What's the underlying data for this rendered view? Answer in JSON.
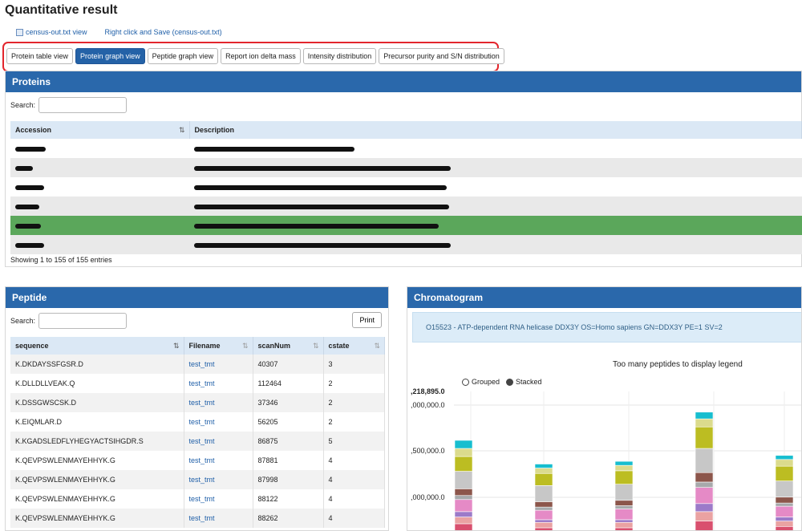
{
  "page": {
    "title": "Quantitative result"
  },
  "links": {
    "view": "census-out.txt view",
    "save": "Right click and Save (census-out.txt)"
  },
  "tabs": [
    {
      "label": "Protein table view",
      "active": false
    },
    {
      "label": "Protein graph view",
      "active": true
    },
    {
      "label": "Peptide graph view",
      "active": false
    },
    {
      "label": "Report ion delta mass",
      "active": false
    },
    {
      "label": "Intensity distribution",
      "active": false
    },
    {
      "label": "Precursor purity and S/N distribution",
      "active": false
    }
  ],
  "proteins": {
    "title": "Proteins",
    "search_label": "Search:",
    "search_value": "",
    "columns": {
      "accession": "Accession",
      "description": "Description"
    },
    "rows": [
      {
        "highlighted": false
      },
      {
        "highlighted": false
      },
      {
        "highlighted": false
      },
      {
        "highlighted": false
      },
      {
        "highlighted": true
      },
      {
        "highlighted": false
      }
    ],
    "footer": "Showing 1 to 155 of 155 entries"
  },
  "peptide": {
    "title": "Peptide",
    "search_label": "Search:",
    "search_value": "",
    "print_label": "Print",
    "columns": {
      "sequence": "sequence",
      "filename": "Filename",
      "scan": "scanNum",
      "cstate": "cstate"
    },
    "rows": [
      {
        "sequence": "K.DKDAYSSFGSR.D",
        "filename": "test_tmt",
        "scan": "40307",
        "cstate": "3"
      },
      {
        "sequence": "K.DLLDLLVEAK.Q",
        "filename": "test_tmt",
        "scan": "112464",
        "cstate": "2"
      },
      {
        "sequence": "K.DSSGWSCSK.D",
        "filename": "test_tmt",
        "scan": "37346",
        "cstate": "2"
      },
      {
        "sequence": "K.EIQMLAR.D",
        "filename": "test_tmt",
        "scan": "56205",
        "cstate": "2"
      },
      {
        "sequence": "K.KGADSLEDFLYHEGYACTSIHGDR.S",
        "filename": "test_tmt",
        "scan": "86875",
        "cstate": "5"
      },
      {
        "sequence": "K.QEVPSWLENMAYEHHYK.G",
        "filename": "test_tmt",
        "scan": "87881",
        "cstate": "4"
      },
      {
        "sequence": "K.QEVPSWLENMAYEHHYK.G",
        "filename": "test_tmt",
        "scan": "87998",
        "cstate": "4"
      },
      {
        "sequence": "K.QEVPSWLENMAYEHHYK.G",
        "filename": "test_tmt",
        "scan": "88122",
        "cstate": "4"
      },
      {
        "sequence": "K.QEVPSWLENMAYEHHYK.G",
        "filename": "test_tmt",
        "scan": "88262",
        "cstate": "4"
      }
    ]
  },
  "chromatogram": {
    "title": "Chromatogram",
    "info": "O15523 - ATP-dependent RNA helicase DDX3Y OS=Homo sapiens GN=DDX3Y PE=1 SV=2",
    "legend_note": "Too many peptides to display legend",
    "modes": {
      "grouped": "Grouped",
      "stacked": "Stacked",
      "selected": "stacked"
    }
  },
  "chart_data": {
    "type": "bar",
    "stacked": true,
    "title": "Too many peptides to display legend",
    "ytick_labels": [
      ",218,895.0",
      ",000,000.0",
      ",500,000.0",
      ",000,000.0",
      ",500,000.0"
    ],
    "ylim": [
      0,
      5218895
    ],
    "legend": "none",
    "grid": true,
    "segment_colors": [
      "#d9506e",
      "#eaa2a2",
      "#9c7ac9",
      "#e58ac6",
      "#a7a9ab",
      "#8c564b",
      "#c7c7c7",
      "#bcbd22",
      "#dbdb8d",
      "#17becf",
      "#9edae5"
    ],
    "series_values_approx": [
      [
        300000,
        250000,
        200000,
        450000,
        150000,
        250000,
        650000,
        550000,
        300000,
        300000
      ],
      [
        150000,
        200000,
        100000,
        350000,
        120000,
        200000,
        600000,
        450000,
        200000,
        150000
      ],
      [
        150000,
        200000,
        100000,
        400000,
        120000,
        200000,
        600000,
        500000,
        200000,
        150000
      ],
      [
        400000,
        350000,
        300000,
        600000,
        200000,
        350000,
        900000,
        800000,
        300000,
        250000
      ],
      [
        200000,
        200000,
        150000,
        400000,
        120000,
        220000,
        600000,
        550000,
        250000,
        150000
      ]
    ]
  }
}
